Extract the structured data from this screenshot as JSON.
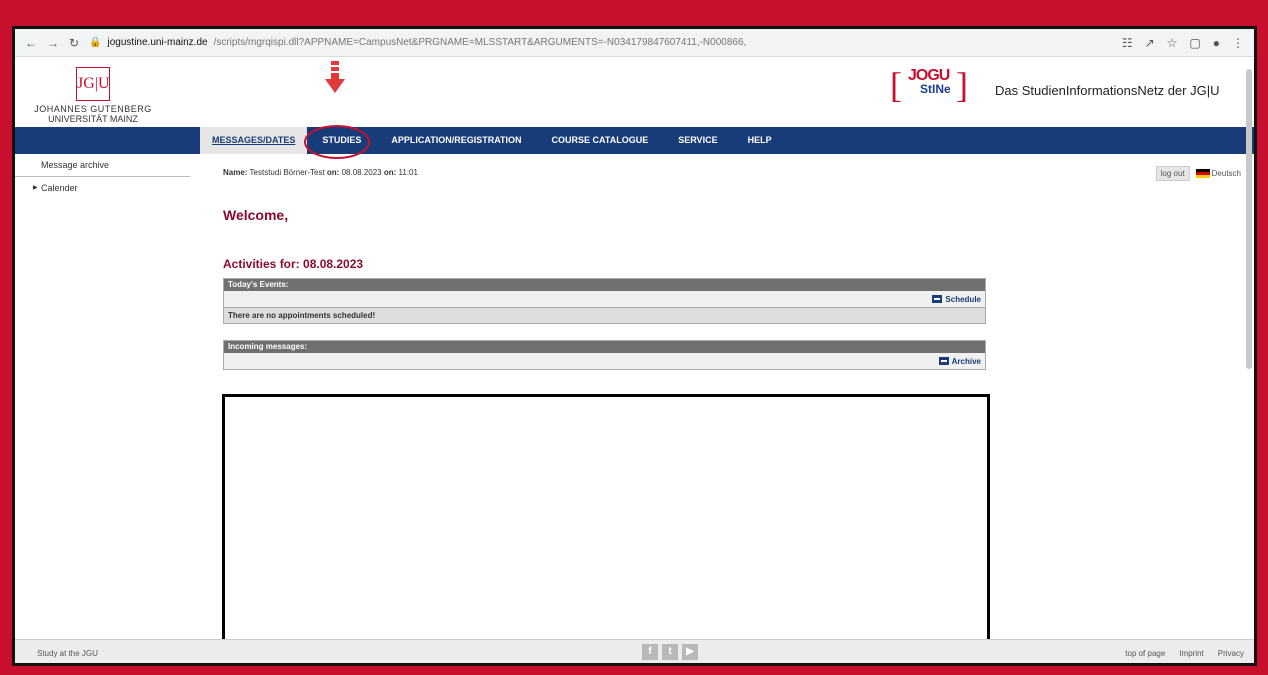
{
  "browser": {
    "url_domain": "jogustine.uni-mainz.de",
    "url_path": "/scripts/mgrqispi.dll?APPNAME=CampusNet&PRGNAME=MLSSTART&ARGUMENTS=-N034179847607411,-N000866,"
  },
  "header": {
    "logo_mark": "JG|U",
    "logo_line1": "JOHANNES GUTENBERG",
    "logo_line2": "UNIVERSITÄT MAINZ",
    "jogu_text": "JOGU",
    "stine_text": "StINe",
    "tagline": "Das StudienInformationsNetz der JG|U"
  },
  "nav": {
    "items": [
      {
        "label": "MESSAGES/DATES"
      },
      {
        "label": "STUDIES"
      },
      {
        "label": "APPLICATION/REGISTRATION"
      },
      {
        "label": "COURSE CATALOGUE"
      },
      {
        "label": "SERVICE"
      },
      {
        "label": "HELP"
      }
    ]
  },
  "sidebar": {
    "items": [
      {
        "label": "Message archive"
      },
      {
        "label": "Calender"
      }
    ]
  },
  "main": {
    "name_label": "Name:",
    "name_value": "Teststudi Börner-Test",
    "on_label1": "on:",
    "date": "08.08.2023",
    "on_label2": "on:",
    "time": "11:01",
    "logout": "log out",
    "language": "Deutsch",
    "welcome": "Welcome,",
    "activities": "Activities for: 08.08.2023",
    "events_header": "Today's Events:",
    "schedule_btn": "Schedule",
    "no_appointments": "There are no appointments scheduled!",
    "messages_header": "Incoming messages:",
    "archive_btn": "Archive"
  },
  "footer": {
    "left": "Study at the JGU",
    "links": [
      "top of page",
      "Imprint",
      "Privacy"
    ]
  },
  "colors": {
    "frame_red": "#c8102e",
    "nav_blue": "#183c7a",
    "heading_red": "#8b0c2c"
  }
}
